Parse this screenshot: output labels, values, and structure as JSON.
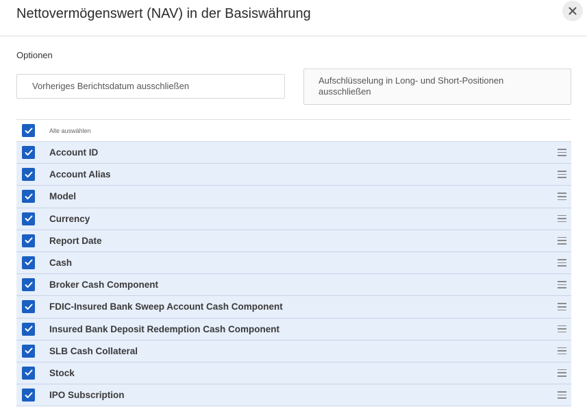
{
  "modal": {
    "title": "Nettovermögenswert (NAV) in der Basiswährung",
    "close_icon": "close-icon"
  },
  "options": {
    "label": "Optionen",
    "exclude_prior_date": "Vorheriges Berichtsdatum ausschließen",
    "exclude_long_short": "Aufschlüsselung in Long- und Short-Positionen ausschließen"
  },
  "fields": {
    "select_all_label": "Alle auswählen",
    "select_all_checked": true,
    "items": [
      {
        "label": "Account ID",
        "checked": true
      },
      {
        "label": "Account Alias",
        "checked": true
      },
      {
        "label": "Model",
        "checked": true
      },
      {
        "label": "Currency",
        "checked": true
      },
      {
        "label": "Report Date",
        "checked": true
      },
      {
        "label": "Cash",
        "checked": true
      },
      {
        "label": "Broker Cash Component",
        "checked": true
      },
      {
        "label": "FDIC-Insured Bank Sweep Account Cash Component",
        "checked": true
      },
      {
        "label": "Insured Bank Deposit Redemption Cash Component",
        "checked": true
      },
      {
        "label": "SLB Cash Collateral",
        "checked": true
      },
      {
        "label": "Stock",
        "checked": true
      },
      {
        "label": "IPO Subscription",
        "checked": true
      }
    ]
  },
  "colors": {
    "checkbox": "#1b5fc1",
    "row_background": "#e7effb"
  }
}
